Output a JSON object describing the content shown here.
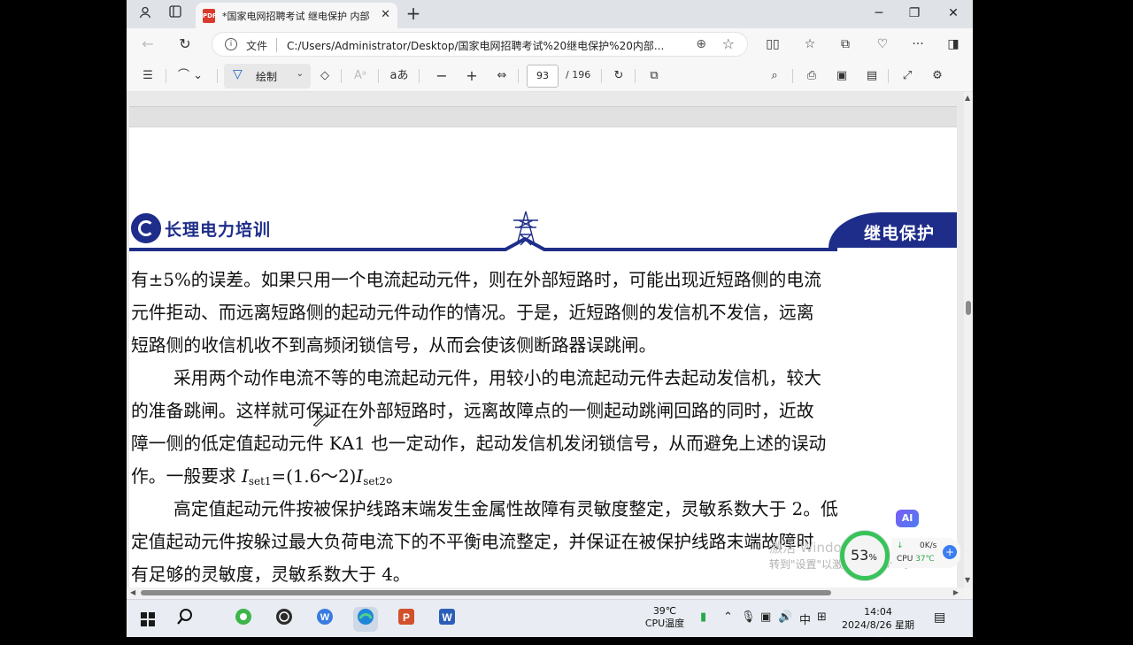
{
  "browser": {
    "tab_title": "*国家电网招聘考试 继电保护 内部",
    "address_label": "文件",
    "url": "C:/Users/Administrator/Desktop/国家电网招聘考试%20继电保护%20内部...",
    "window_controls": [
      "minimize",
      "restore",
      "close"
    ]
  },
  "pdf_toolbar": {
    "draw_label": "绘制",
    "read_aloud_label": "aあ",
    "page_current": "93",
    "page_total": "/ 196"
  },
  "document": {
    "brand": "长理电力培训",
    "section_tab": "继电保护",
    "lines": [
      "有±5%的误差。如果只用一个电流起动元件，则在外部短路时，可能出现近短路侧的电流",
      "元件拒动、而远离短路侧的起动元件动作的情况。于是，近短路侧的发信机不发信，远离",
      "短路侧的收信机收不到高频闭锁信号，从而会使该侧断路器误跳闸。",
      "采用两个动作电流不等的电流起动元件，用较小的电流起动元件去起动发信机，较大",
      "的准备跳闸。这样就可保证在外部短路时，远离故障点的一侧起动跳闸回路的同时，近故",
      "障一侧的低定值起动元件 KA1 也一定动作，起动发信机发闭锁信号，从而避免上述的误动",
      "高定值起动元件按被保护线路末端发生金属性故障有灵敏度整定，灵敏系数大于 2。低",
      "定值起动元件按躲过最大负荷电流下的不平衡电流整定，并保证在被保护线路末端故障时",
      "有足够的灵敏度，灵敏系数大于 4。"
    ],
    "formula": {
      "prefix": "作。一般要求 ",
      "i1": "I",
      "sub1": "set1",
      "mid": "=(1.6～2)",
      "i2": "I",
      "sub2": "set2",
      "suffix": "。"
    }
  },
  "overlays": {
    "ai_badge": "AI",
    "activation_line1": "激活 Windows",
    "activation_line2": "转到\"设置\"以激活 Windows。",
    "perf_percent": "53",
    "perf_percent_unit": "%",
    "net_speed": "0K/s",
    "cpu_label": "CPU",
    "cpu_temp": "37℃"
  },
  "taskbar": {
    "temp_value": "39℃",
    "temp_label": "CPU温度",
    "ime": "中",
    "time": "14:04",
    "date": "2024/8/26 星期一"
  },
  "colors": {
    "brand_blue": "#1e2d8a",
    "perf_green": "#37c35a"
  }
}
